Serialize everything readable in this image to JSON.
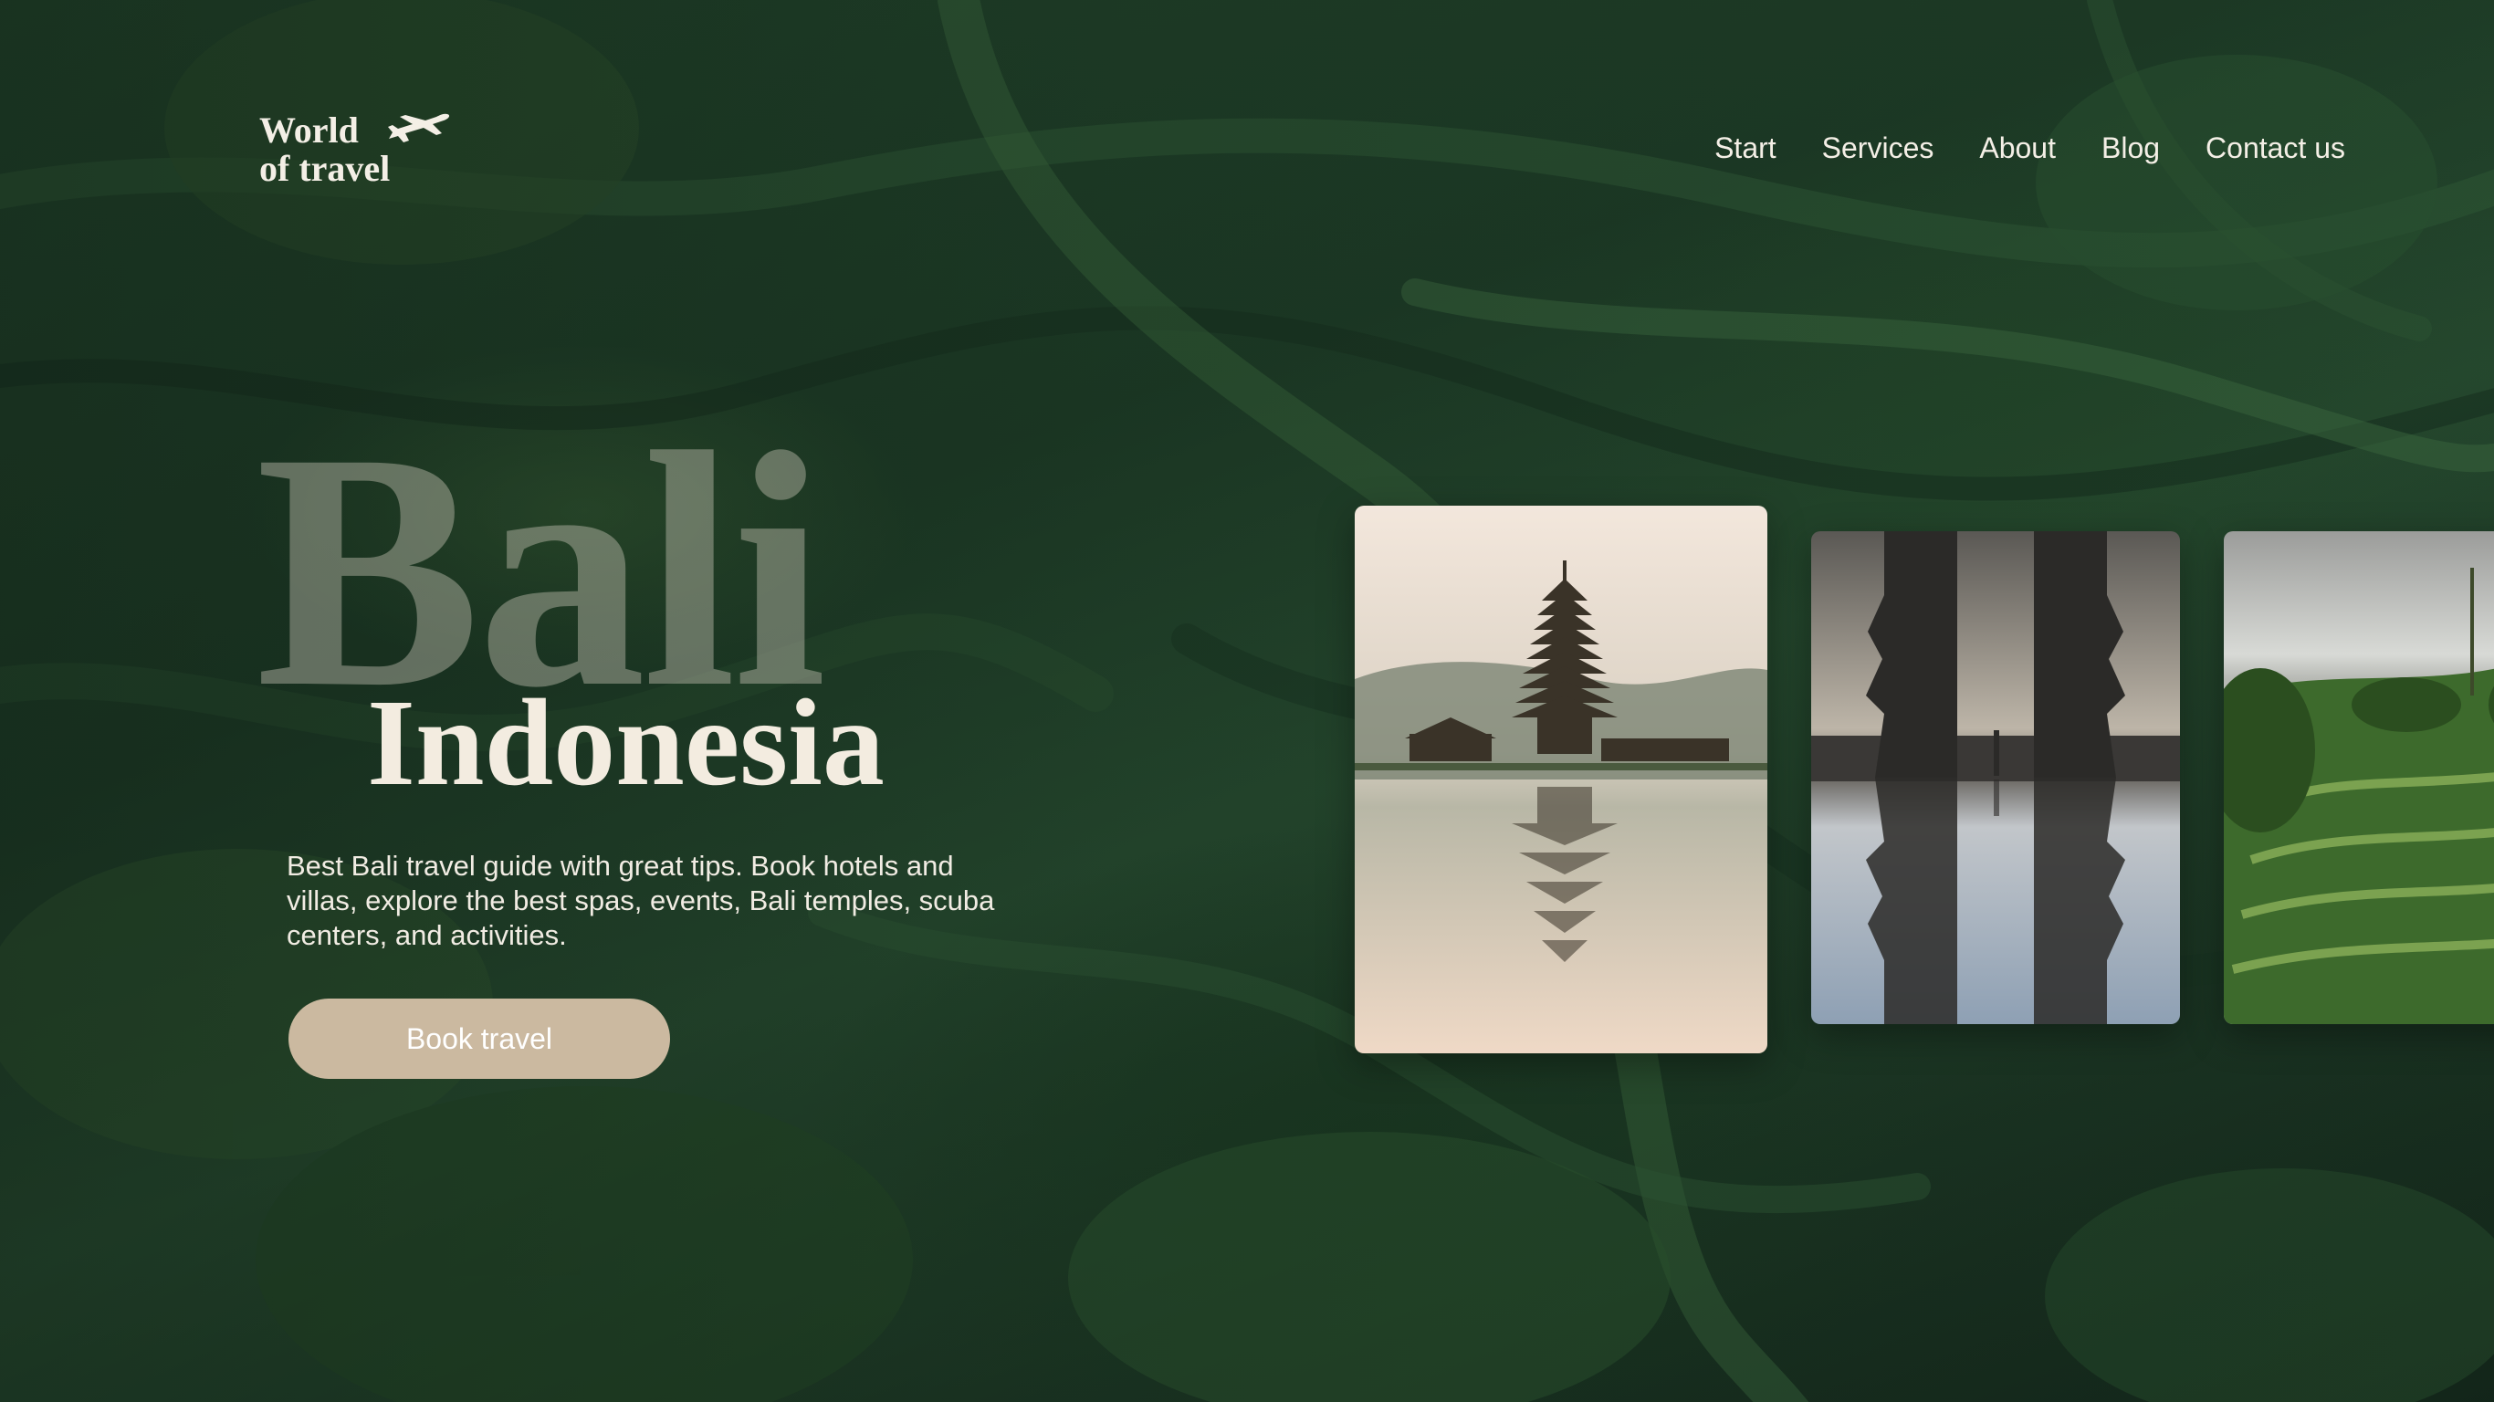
{
  "brand": {
    "logo_line1": "World",
    "logo_line2": "of travel",
    "logo_icon": "airplane-icon"
  },
  "nav": {
    "items": [
      {
        "label": "Start"
      },
      {
        "label": "Services"
      },
      {
        "label": "About"
      },
      {
        "label": "Blog"
      },
      {
        "label": "Contact us"
      }
    ]
  },
  "hero": {
    "background_word": "Bali",
    "title": "Indonesia",
    "description": "Best Bali travel guide with great tips. Book hotels and villas, explore the best spas, events, Bali temples, scuba centers, and activities.",
    "cta_label": "Book travel"
  },
  "cards": [
    {
      "name": "temple-on-lake-photo"
    },
    {
      "name": "temple-gate-reflection-photo"
    },
    {
      "name": "rice-terraces-photo"
    }
  ],
  "colors": {
    "accent": "#cbb9a0",
    "text_light": "#f3ece0",
    "background_green": "#1d3b26"
  }
}
